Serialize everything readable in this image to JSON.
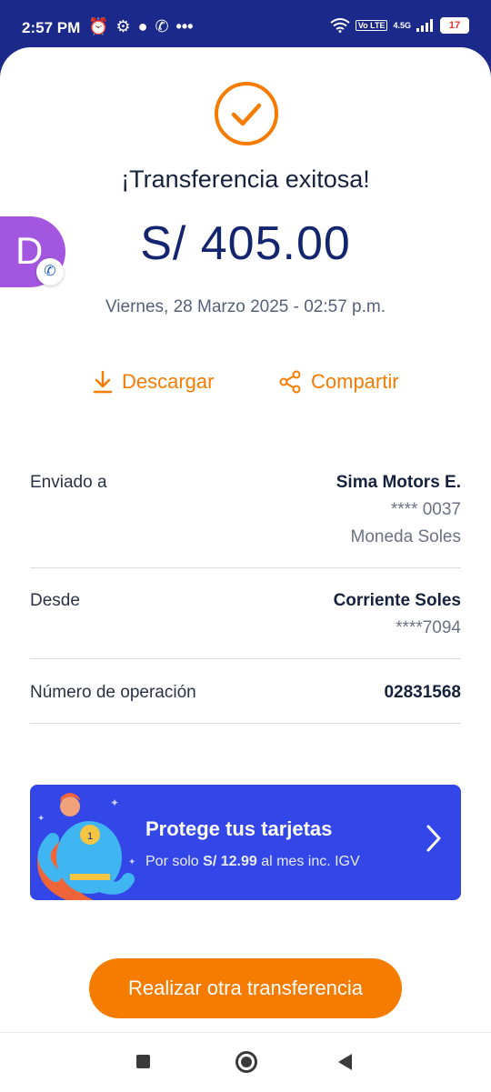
{
  "status_bar": {
    "time": "2:57 PM",
    "left_icons": [
      "alarm-icon",
      "gear-icon",
      "chat-icon",
      "call-icon",
      "more-icon"
    ],
    "right_icons": [
      "wifi-icon",
      "volte-icon",
      "signal-icon"
    ],
    "network": "4.5G",
    "battery": "17"
  },
  "receipt": {
    "title": "¡Transferencia exitosa!",
    "amount": "S/ 405.00",
    "datetime": "Viernes, 28 Marzo 2025 - 02:57 p.m.",
    "avatar_letter": "D"
  },
  "actions": {
    "download": "Descargar",
    "share": "Compartir"
  },
  "details": {
    "sent_to_label": "Enviado a",
    "sent_to_name": "Sima Motors E.",
    "sent_to_account": "**** 0037",
    "sent_to_currency": "Moneda Soles",
    "from_label": "Desde",
    "from_account_name": "Corriente Soles",
    "from_account_number": "****7094",
    "operation_label": "Número de operación",
    "operation_number": "02831568"
  },
  "promo": {
    "title": "Protege tus tarjetas",
    "sub_prefix": "Por solo ",
    "sub_price": "S/ 12.99",
    "sub_suffix": " al mes inc. IGV"
  },
  "cta": {
    "label": "Realizar otra transferencia"
  },
  "colors": {
    "accent": "#f57c00",
    "brand": "#12256e",
    "promo_bg": "#3346e8",
    "status_bar": "#1b2a8a"
  }
}
